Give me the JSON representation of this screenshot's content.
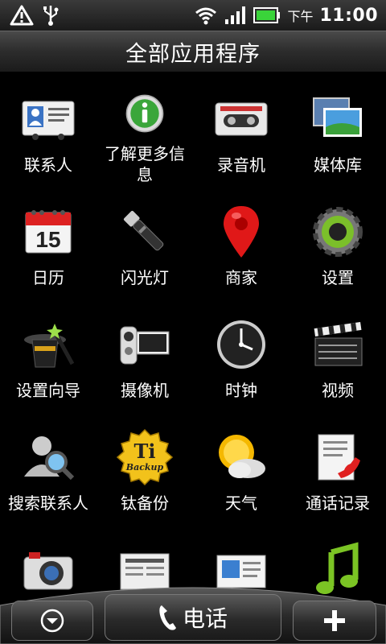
{
  "status_bar": {
    "icons": [
      "warning-icon",
      "usb-icon",
      "wifi-icon",
      "signal-icon",
      "battery-icon"
    ],
    "ampm": "下午",
    "time": "11:00"
  },
  "title": "全部应用程序",
  "apps": [
    {
      "label": "联系人",
      "icon": "contacts-icon"
    },
    {
      "label": "了解更多信息",
      "icon": "info-icon"
    },
    {
      "label": "录音机",
      "icon": "voice-recorder-icon"
    },
    {
      "label": "媒体库",
      "icon": "gallery-icon"
    },
    {
      "label": "日历",
      "icon": "calendar-icon",
      "date": "15"
    },
    {
      "label": "闪光灯",
      "icon": "flashlight-icon"
    },
    {
      "label": "商家",
      "icon": "places-pin-icon"
    },
    {
      "label": "设置",
      "icon": "settings-gear-icon"
    },
    {
      "label": "设置向导",
      "icon": "magic-hat-icon"
    },
    {
      "label": "摄像机",
      "icon": "camcorder-icon"
    },
    {
      "label": "时钟",
      "icon": "clock-icon"
    },
    {
      "label": "视频",
      "icon": "clapperboard-icon"
    },
    {
      "label": "搜索联系人",
      "icon": "people-search-icon"
    },
    {
      "label": "钛备份",
      "icon": "titanium-backup-icon",
      "badge_top": "Ti",
      "badge_bottom": "Backup"
    },
    {
      "label": "天气",
      "icon": "weather-icon"
    },
    {
      "label": "通话记录",
      "icon": "call-log-icon"
    },
    {
      "label": "",
      "icon": "camera-icon"
    },
    {
      "label": "",
      "icon": "news-icon"
    },
    {
      "label": "",
      "icon": "photo-card-icon"
    },
    {
      "label": "",
      "icon": "music-note-icon"
    }
  ],
  "dock": {
    "left_icon": "collapse-down-icon",
    "phone_label": "电话",
    "phone_icon": "phone-handset-icon",
    "right_icon": "plus-icon"
  }
}
